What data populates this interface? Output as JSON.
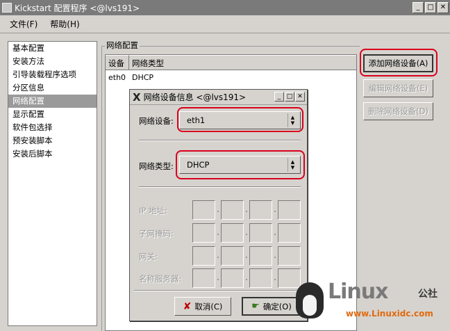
{
  "window": {
    "title": "Kickstart 配置程序 <@lvs191>",
    "buttons": [
      "minimize-icon",
      "maximize-icon",
      "close-icon"
    ]
  },
  "menu": {
    "file": "文件(F)",
    "help": "帮助(H)"
  },
  "sidebar": {
    "items": [
      {
        "label": "基本配置"
      },
      {
        "label": "安装方法"
      },
      {
        "label": "引导装载程序选项"
      },
      {
        "label": "分区信息"
      },
      {
        "label": "网络配置",
        "selected": true
      },
      {
        "label": "显示配置"
      },
      {
        "label": "软件包选择"
      },
      {
        "label": "预安装脚本"
      },
      {
        "label": "安装后脚本"
      }
    ]
  },
  "network": {
    "group_title": "网络配置",
    "columns": [
      "设备",
      "网络类型"
    ],
    "rows": [
      {
        "device": "eth0",
        "type": "DHCP"
      }
    ]
  },
  "actions": {
    "add": "添加网络设备(A)",
    "edit": "编辑网络设备(E)",
    "delete": "删除网络设备(D)"
  },
  "dialog": {
    "title": "网络设备信息 <@lvs191>",
    "device_label": "网络设备:",
    "device_value": "eth1",
    "type_label": "网络类型:",
    "type_value": "DHCP",
    "ip_label": "IP 地址:",
    "netmask_label": "子网掩码:",
    "gateway_label": "网关:",
    "dns_label": "名称服务器:",
    "cancel": "取消(C)",
    "ok": "确定(O)"
  },
  "watermark": {
    "brand": "Linux",
    "suffix": "公社",
    "site": "www.Linuxidc.com"
  },
  "colors": {
    "highlight": "#d8001c",
    "selection": "#9a9a9a",
    "background": "#d6d3ce"
  }
}
